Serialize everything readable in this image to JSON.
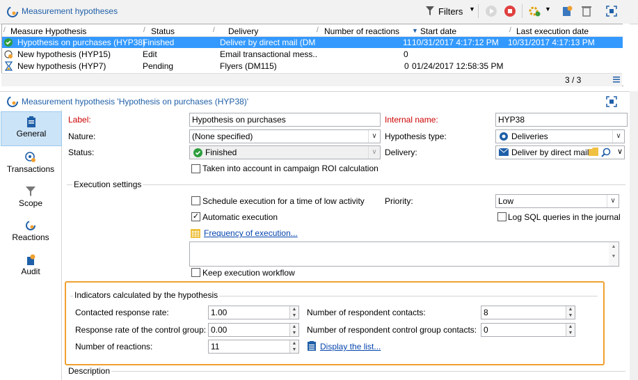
{
  "app": {
    "list_title": "Measurement hypotheses",
    "filters_label": "Filters",
    "pager": "3 / 3"
  },
  "list": {
    "columns": [
      "Measure Hypothesis",
      "Status",
      "Delivery",
      "Number of reactions",
      "Start date",
      "Last execution date"
    ],
    "rows": [
      {
        "name": "Hypothesis on purchases (HYP38)",
        "status": "Finished",
        "delivery": "Deliver by direct mail (DM",
        "reactions": "11",
        "start": "10/31/2017 4:17:12 PM",
        "last": "10/31/2017 4:17:13 PM",
        "icon": "check-circle-icon",
        "selected": true
      },
      {
        "name": "New hypothesis (HYP15)",
        "status": "Edit",
        "delivery": "Email transactional mess..",
        "reactions": "0",
        "start": "",
        "last": "",
        "icon": "edit-icon",
        "selected": false
      },
      {
        "name": "New hypothesis (HYP7)",
        "status": "Pending",
        "delivery": "Flyers (DM115)",
        "reactions": "0",
        "start": "01/24/2017 12:58:35 PM",
        "last": "",
        "icon": "hourglass-icon",
        "selected": false
      }
    ]
  },
  "detail": {
    "title": "Measurement hypothesis 'Hypothesis on purchases (HYP38)'"
  },
  "nav": {
    "items": [
      {
        "label": "General",
        "icon": "clipboard-icon",
        "active": true
      },
      {
        "label": "Transactions",
        "icon": "target-icon",
        "active": false
      },
      {
        "label": "Scope",
        "icon": "funnel-icon",
        "active": false
      },
      {
        "label": "Reactions",
        "icon": "hypothesis-icon",
        "active": false
      },
      {
        "label": "Audit",
        "icon": "audit-icon",
        "active": false
      }
    ]
  },
  "form": {
    "label_lbl": "Label:",
    "label_val": "Hypothesis on purchases",
    "internal_lbl": "Internal name:",
    "internal_val": "HYP38",
    "nature_lbl": "Nature:",
    "nature_val": "(None specified)",
    "hyptype_lbl": "Hypothesis type:",
    "hyptype_val": "Deliveries",
    "status_lbl": "Status:",
    "status_val": "Finished",
    "delivery_lbl": "Delivery:",
    "delivery_val": "Deliver by direct mail",
    "roi_lbl": "Taken into account in campaign ROI calculation",
    "exec_title": "Execution settings",
    "schedule_lbl": "Schedule execution for a time of low activity",
    "priority_lbl": "Priority:",
    "priority_val": "Low",
    "auto_lbl": "Automatic execution",
    "logsql_lbl": "Log SQL queries in the journal",
    "freq_link": "Frequency of execution...",
    "keepwf_lbl": "Keep execution workflow",
    "ind_title": "Indicators calculated by the hypothesis",
    "contacted_lbl": "Contacted response rate:",
    "contacted_val": "1.00",
    "control_lbl": "Response rate of the control group:",
    "control_val": "0.00",
    "reactions_lbl": "Number of reactions:",
    "reactions_val": "11",
    "respcontacts_lbl": "Number of respondent contacts:",
    "respcontacts_val": "8",
    "respcontrol_lbl": "Number of respondent control group contacts:",
    "respcontrol_val": "0",
    "display_link": "Display the list...",
    "description_lbl": "Description"
  },
  "colors": {
    "accent": "#1f5fa8",
    "selection": "#3399ff",
    "highlight_box": "#f0a030",
    "required": "#cc0000"
  }
}
